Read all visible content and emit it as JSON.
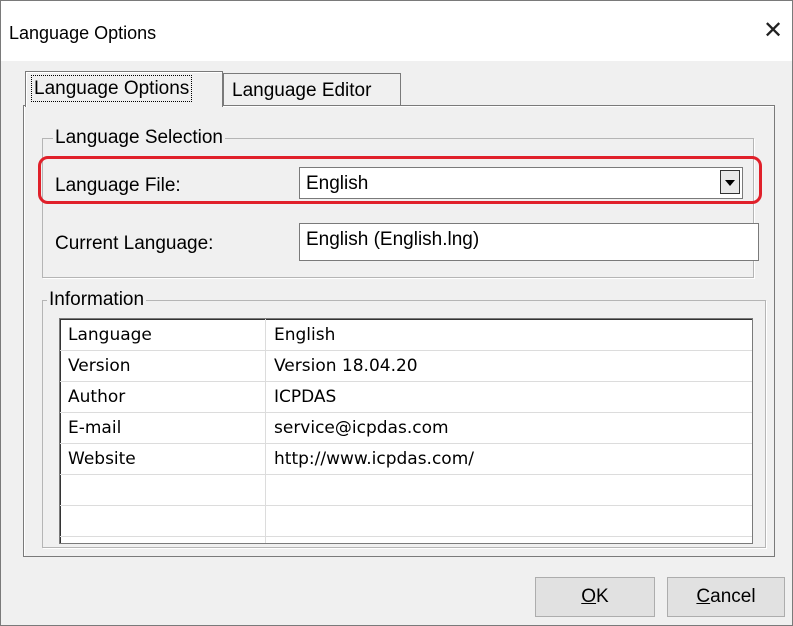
{
  "window": {
    "title": "Language Options",
    "close_glyph": "✕"
  },
  "tabs": [
    {
      "label": "Language Options",
      "active": true
    },
    {
      "label": "Language Editor",
      "active": false
    }
  ],
  "language_selection": {
    "legend": "Language Selection",
    "file_label": "Language File:",
    "file_value": "English",
    "current_label": "Current Language:",
    "current_value": "English (English.lng)",
    "highlight_color": "#e0202a"
  },
  "information": {
    "legend": "Information",
    "rows": [
      {
        "key": "Language",
        "value": "English"
      },
      {
        "key": "Version",
        "value": "Version 18.04.20"
      },
      {
        "key": "Author",
        "value": "ICPDAS"
      },
      {
        "key": "E-mail",
        "value": "service@icpdas.com"
      },
      {
        "key": "Website",
        "value": "http://www.icpdas.com/"
      },
      {
        "key": "",
        "value": ""
      },
      {
        "key": "",
        "value": ""
      }
    ]
  },
  "buttons": {
    "ok": {
      "mnemonic": "O",
      "rest": "K"
    },
    "cancel": {
      "mnemonic": "C",
      "rest": "ancel"
    }
  }
}
